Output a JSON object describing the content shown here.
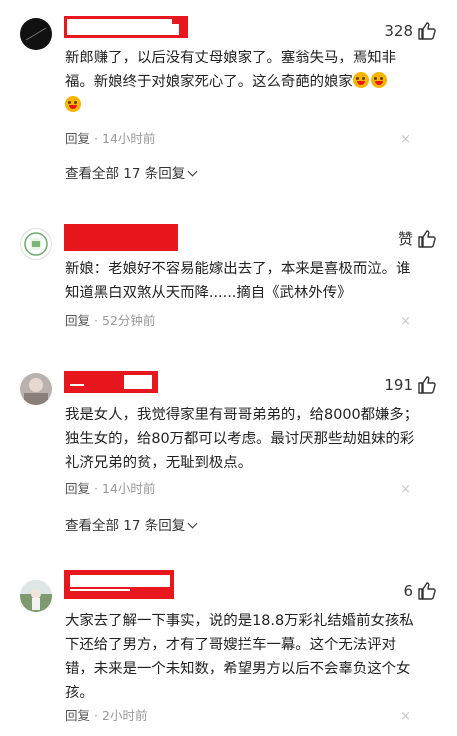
{
  "comments": [
    {
      "likes": "328",
      "text": "新郎赚了，以后没有丈母娘家了。塞翁失马，焉知非福。新娘终于对娘家死心了。这么奇葩的娘家",
      "emoji_count": 3,
      "reply_label": "回复",
      "time": "14小时前",
      "close": "×",
      "view_replies": "查看全部 17 条回复",
      "avatar_style": "dark"
    },
    {
      "likes": "赞",
      "text": "新娘：老娘好不容易能嫁出去了，本来是喜极而泣。谁知道黑白双煞从天而降......摘自《武林外传》",
      "reply_label": "回复",
      "time": "52分钟前",
      "close": "×",
      "avatar_style": "badge"
    },
    {
      "likes": "191",
      "text": "我是女人，我觉得家里有哥哥弟弟的，给8000都嫌多；独生女的，给80万都可以考虑。最讨厌那些劫姐妹的彩礼济兄弟的贫，无耻到极点。",
      "reply_label": "回复",
      "time": "14小时前",
      "close": "×",
      "view_replies": "查看全部 17 条回复",
      "avatar_style": "photo"
    },
    {
      "likes": "6",
      "text": "大家去了解一下事实，说的是18.8万彩礼结婚前女孩私下还给了男方，才有了哥嫂拦车一幕。这个无法评对错，未来是一个未知数，希望男方以后不会辜负这个女孩。",
      "reply_label": "回复",
      "time": "2小时前",
      "close": "×",
      "avatar_style": "outdoor"
    }
  ]
}
